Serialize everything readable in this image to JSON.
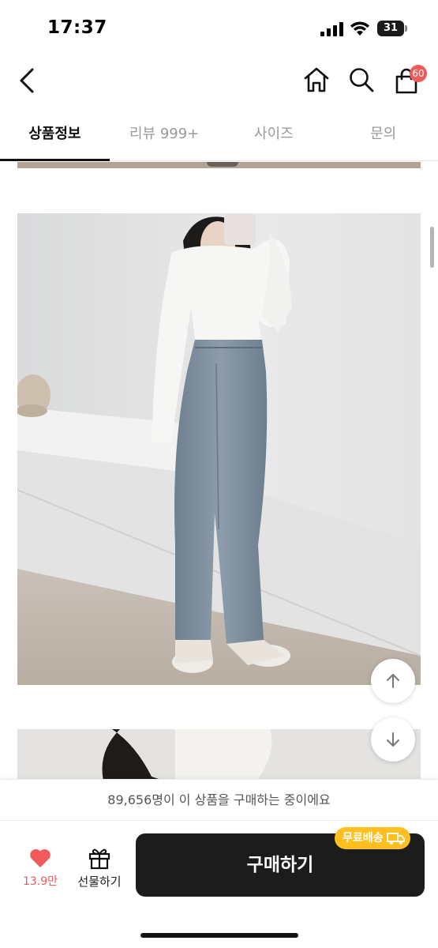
{
  "status_bar": {
    "time": "17:37",
    "battery_level": "31"
  },
  "header": {
    "back_icon": "chevron-left-icon",
    "home_icon": "home-icon",
    "search_icon": "search-icon",
    "cart_icon": "shopping-bag-icon",
    "cart_badge": "60"
  },
  "tabs": [
    {
      "label": "상품정보",
      "active": true
    },
    {
      "label": "리뷰 999+",
      "active": false
    },
    {
      "label": "사이즈",
      "active": false
    },
    {
      "label": "문의",
      "active": false
    }
  ],
  "floating_buttons": {
    "scroll_up_icon": "arrow-up-icon",
    "scroll_down_icon": "arrow-down-icon"
  },
  "bottom_bar": {
    "buyer_notice": "89,656명이 이 상품을 구매하는 중이에요",
    "like_count": "13.9만",
    "gift_label": "선물하기",
    "buy_label": "구매하기",
    "free_shipping_label": "무료배송"
  },
  "colors": {
    "accent_red": "#f05a5a",
    "buy_button": "#1c1c1c",
    "free_shipping_badge": "#ffbf1f"
  }
}
